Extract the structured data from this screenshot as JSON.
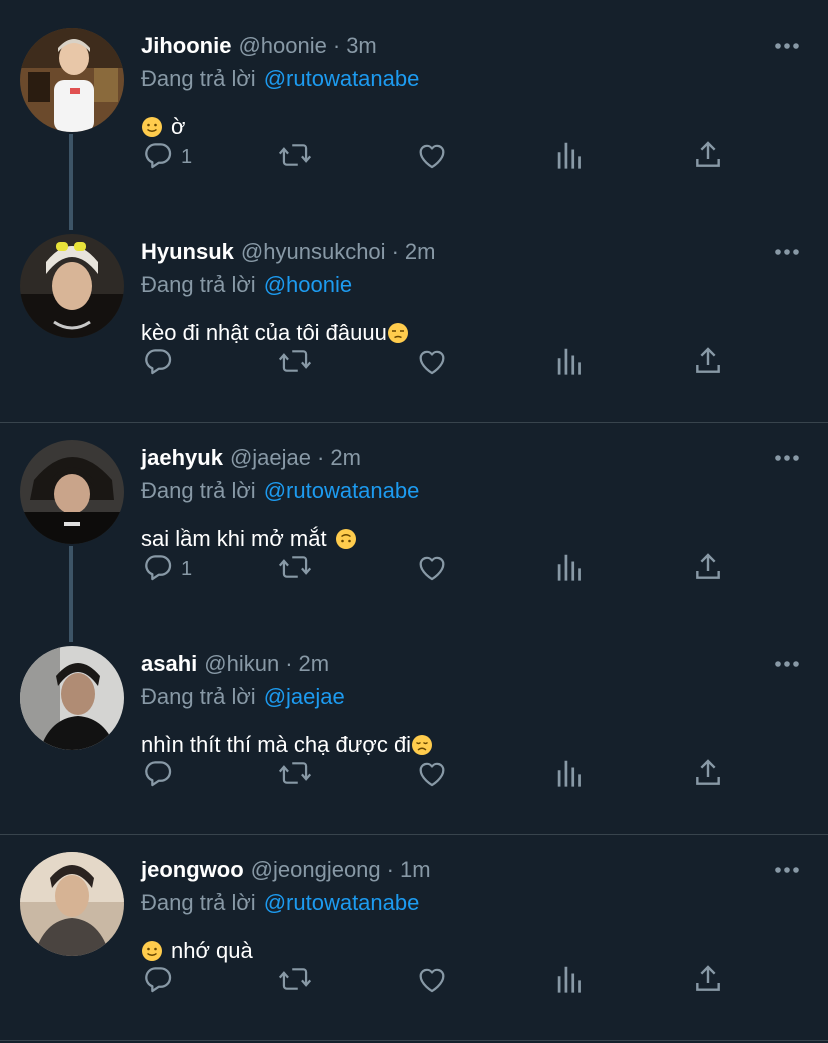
{
  "colors": {
    "background": "#15202b",
    "text_primary": "#ffffff",
    "text_secondary": "#8899a6",
    "mention": "#1d9bf0",
    "divider": "#38444d",
    "thread_line": "#3d5466"
  },
  "tweets": [
    {
      "name": "Jihoonie",
      "handle": "@hoonie",
      "separator": "·",
      "time": "3m",
      "reply_prefix": "Đang trả lời",
      "reply_to": "@rutowatanabe",
      "text": "ờ",
      "emoji_before": "slightly-smiling-face",
      "emoji_after": "",
      "reply_count": "1",
      "icons": [
        "reply-icon",
        "retweet-icon",
        "like-icon",
        "analytics-icon",
        "share-icon",
        "more-icon"
      ]
    },
    {
      "name": "Hyunsuk",
      "handle": "@hyunsukchoi",
      "separator": "·",
      "time": "2m",
      "reply_prefix": "Đang trả lời",
      "reply_to": "@hoonie",
      "text": "kèo đi nhật của tôi đâuuu",
      "emoji_before": "",
      "emoji_after": "unamused-face",
      "reply_count": "",
      "icons": [
        "reply-icon",
        "retweet-icon",
        "like-icon",
        "analytics-icon",
        "share-icon",
        "more-icon"
      ]
    },
    {
      "name": "jaehyuk",
      "handle": "@jaejae",
      "separator": "·",
      "time": "2m",
      "reply_prefix": "Đang trả lời",
      "reply_to": "@rutowatanabe",
      "text": "sai lầm khi mở mắt",
      "emoji_before": "",
      "emoji_after": "upside-down-face",
      "reply_count": "1",
      "icons": [
        "reply-icon",
        "retweet-icon",
        "like-icon",
        "analytics-icon",
        "share-icon",
        "more-icon"
      ]
    },
    {
      "name": "asahi",
      "handle": "@hikun",
      "separator": "·",
      "time": "2m",
      "reply_prefix": "Đang trả lời",
      "reply_to": "@jaejae",
      "text": "nhìn thít thí mà chạ được đi",
      "emoji_before": "",
      "emoji_after": "disappointed-face",
      "reply_count": "",
      "icons": [
        "reply-icon",
        "retweet-icon",
        "like-icon",
        "analytics-icon",
        "share-icon",
        "more-icon"
      ]
    },
    {
      "name": "jeongwoo",
      "handle": "@jeongjeong",
      "separator": "·",
      "time": "1m",
      "reply_prefix": "Đang trả lời",
      "reply_to": "@rutowatanabe",
      "text": "nhớ quà",
      "emoji_before": "slightly-smiling-face",
      "emoji_after": "",
      "reply_count": "",
      "icons": [
        "reply-icon",
        "retweet-icon",
        "like-icon",
        "analytics-icon",
        "share-icon",
        "more-icon"
      ]
    }
  ]
}
